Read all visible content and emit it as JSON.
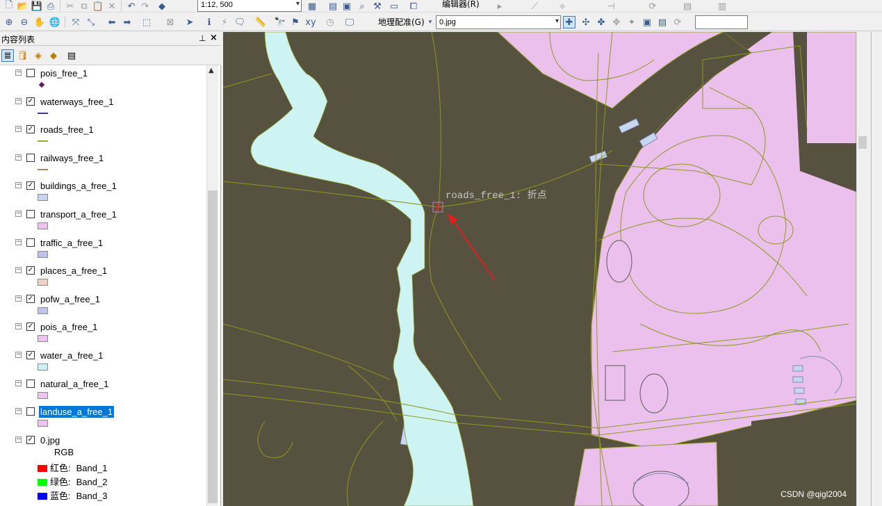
{
  "toolbar": {
    "scale_value": "1:12, 500",
    "editor_menu": "编辑器(R)",
    "georeference_menu": "地理配准(G)",
    "raster_layer_value": "0.jpg",
    "icons": [
      "new-icon",
      "open-icon",
      "save-icon",
      "print-icon",
      "cut-icon",
      "copy-icon",
      "paste-icon",
      "delete-icon",
      "undo-icon",
      "redo-icon",
      "add-data-icon",
      "zoom-in-icon",
      "zoom-out-icon",
      "pan-icon",
      "full-extent-icon",
      "back-icon",
      "forward-icon",
      "select-icon",
      "identify-icon",
      "find-icon",
      "measure-icon"
    ]
  },
  "toc": {
    "title": "内容列表",
    "pin": "ᵖ",
    "close": "×",
    "layers": [
      {
        "name": "pois_free_1",
        "checked": false,
        "symbol": "point",
        "color": "#5a1a6e"
      },
      {
        "name": "waterways_free_1",
        "checked": true,
        "symbol": "line",
        "color": "#3a3a8c"
      },
      {
        "name": "roads_free_1",
        "checked": true,
        "symbol": "line",
        "color": "#9aa832"
      },
      {
        "name": "railways_free_1",
        "checked": false,
        "symbol": "line",
        "color": "#b0805a"
      },
      {
        "name": "buildings_a_free_1",
        "checked": true,
        "symbol": "fill",
        "color": "#c6d4f0"
      },
      {
        "name": "transport_a_free_1",
        "checked": false,
        "symbol": "fill",
        "color": "#efc3ef"
      },
      {
        "name": "traffic_a_free_1",
        "checked": false,
        "symbol": "fill",
        "color": "#c0c4ec"
      },
      {
        "name": "places_a_free_1",
        "checked": true,
        "symbol": "fill",
        "color": "#f1d3c4"
      },
      {
        "name": "pofw_a_free_1",
        "checked": true,
        "symbol": "fill",
        "color": "#c0c4ec"
      },
      {
        "name": "pois_a_free_1",
        "checked": true,
        "symbol": "fill",
        "color": "#efc3ef"
      },
      {
        "name": "water_a_free_1",
        "checked": true,
        "symbol": "fill",
        "color": "#cbf3f3"
      },
      {
        "name": "natural_a_free_1",
        "checked": false,
        "symbol": "fill",
        "color": "#efc3ef"
      },
      {
        "name": "landuse_a_free_1",
        "checked": false,
        "symbol": "fill",
        "color": "#efc3ef",
        "selected": true
      },
      {
        "name": "0.jpg",
        "checked": true,
        "symbol": "raster"
      }
    ],
    "raster_legend": {
      "label": "RGB",
      "bands": [
        {
          "label": "红色:",
          "band": "Band_1",
          "color": "#ff0000"
        },
        {
          "label": "绿色:",
          "band": "Band_2",
          "color": "#00ff00"
        },
        {
          "label": "蓝色:",
          "band": "Band_3",
          "color": "#0000ff"
        }
      ]
    }
  },
  "map": {
    "snap_tooltip": "roads_free_1: 折点",
    "watermark": "CSDN @qigl2004",
    "colors": {
      "background": "#57523f",
      "landuse": "#ecc0ec",
      "water": "#cdf3f3",
      "roads": "#8b9a1e",
      "building": "#c8d6f2",
      "arrow": "#e02020"
    }
  }
}
